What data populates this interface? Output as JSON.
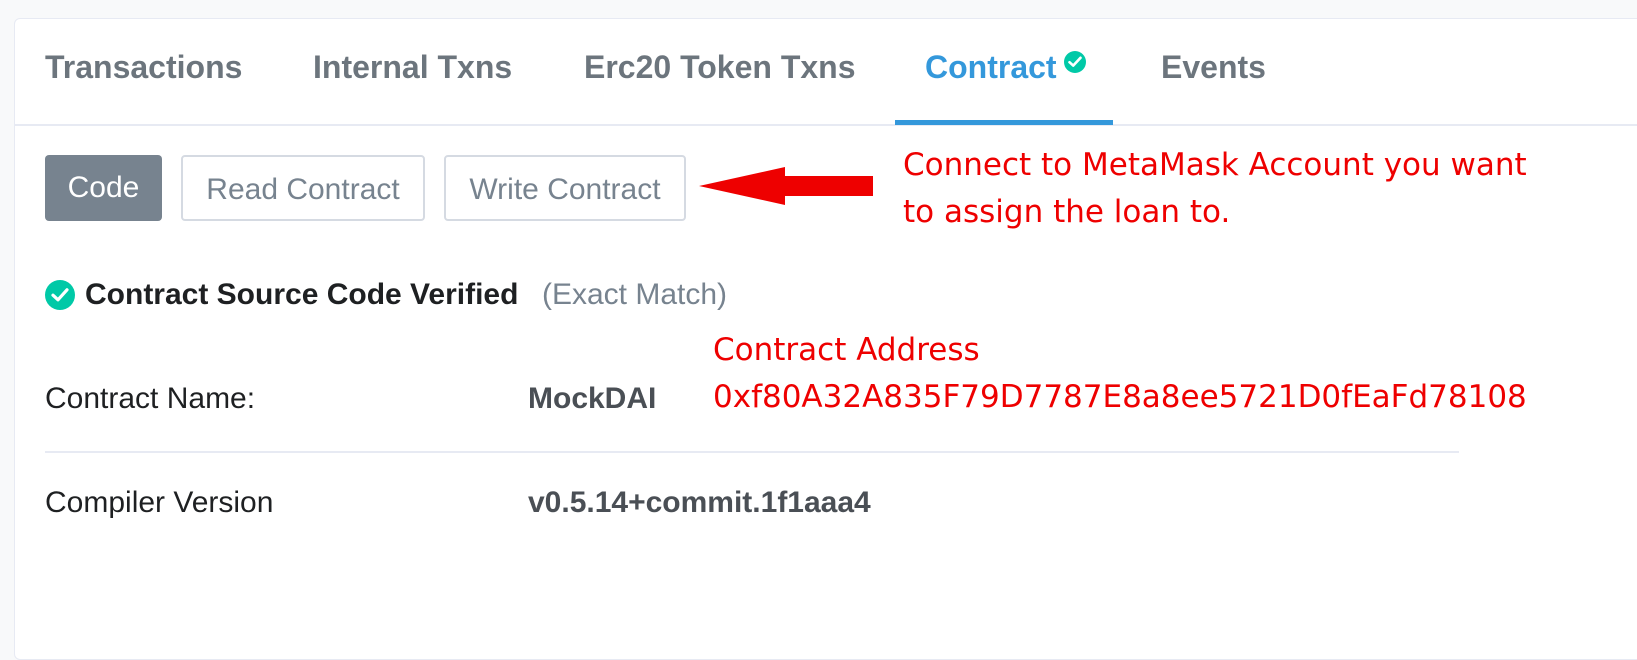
{
  "tabs": [
    {
      "label": "Transactions"
    },
    {
      "label": "Internal Txns"
    },
    {
      "label": "Erc20 Token Txns"
    },
    {
      "label": "Contract",
      "active": true,
      "verified": true
    },
    {
      "label": "Events"
    }
  ],
  "code_buttons": {
    "code": "Code",
    "read": "Read Contract",
    "write": "Write Contract"
  },
  "annotations": {
    "metamask_line1": "Connect to MetaMask Account you want",
    "metamask_line2": "to assign the loan to.",
    "address_label": "Contract Address",
    "address_value": "0xf80A32A835F79D7787E8a8ee5721D0fEaFd78108"
  },
  "verification": {
    "title": "Contract Source Code Verified",
    "subtitle": "(Exact Match)"
  },
  "details": {
    "contract_name_label": "Contract Name:",
    "contract_name_value": "MockDAI",
    "compiler_label": "Compiler Version",
    "compiler_value": "v0.5.14+commit.1f1aaa4"
  },
  "colors": {
    "accent": "#3498db",
    "success": "#00c9a7",
    "annotation": "#ee0000",
    "muted": "#77838f"
  },
  "icons": {
    "tab_verified": "check-circle-icon",
    "source_verified": "check-circle-icon",
    "pointer": "red-arrow-left-icon"
  }
}
